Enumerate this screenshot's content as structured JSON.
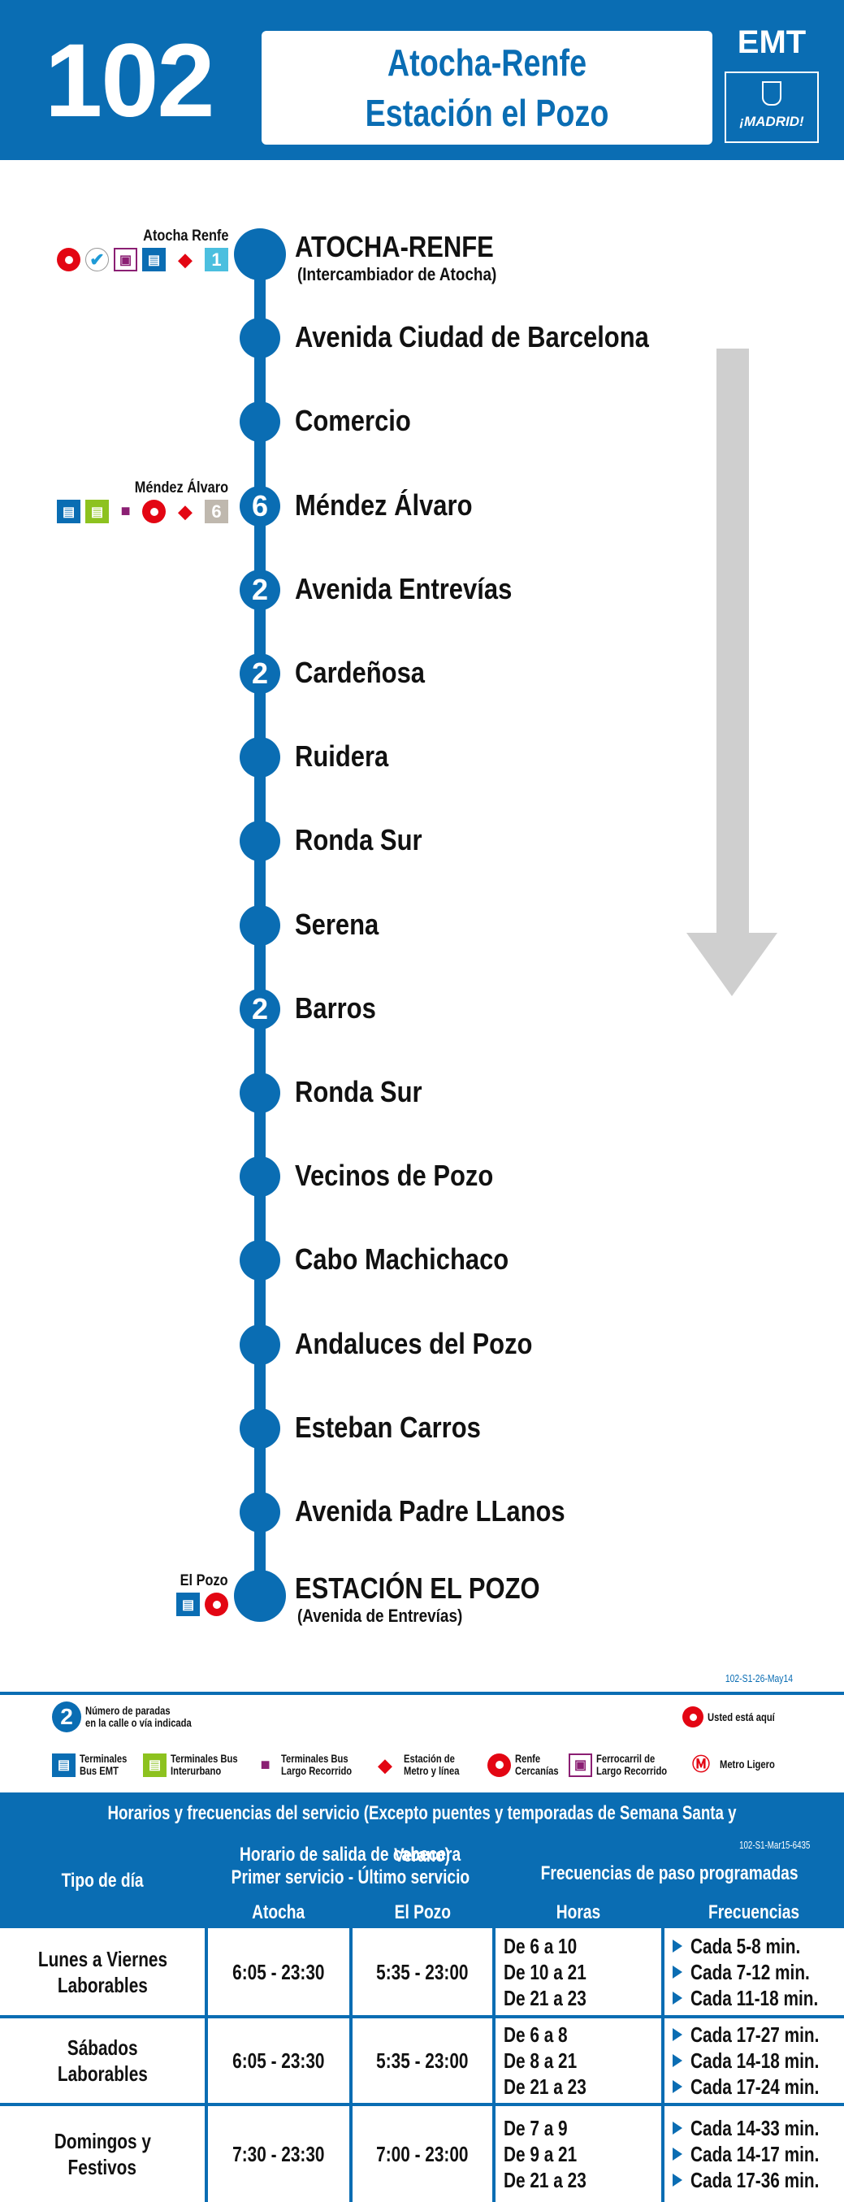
{
  "header": {
    "line_number": "102",
    "destinations": [
      "Atocha-Renfe",
      "Estación el Pozo"
    ],
    "operator": "EMT",
    "city_logo": "¡MADRID!"
  },
  "stops": [
    {
      "name": "ATOCHA-RENFE",
      "sub": "(Intercambiador de Atocha)",
      "badge": "",
      "terminal": true
    },
    {
      "name": "Avenida Ciudad de Barcelona",
      "badge": ""
    },
    {
      "name": "Comercio",
      "badge": ""
    },
    {
      "name": "Méndez Álvaro",
      "badge": "6"
    },
    {
      "name": "Avenida Entrevías",
      "badge": "2"
    },
    {
      "name": "Cardeñosa",
      "badge": "2"
    },
    {
      "name": "Ruidera",
      "badge": ""
    },
    {
      "name": "Ronda Sur",
      "badge": ""
    },
    {
      "name": "Serena",
      "badge": ""
    },
    {
      "name": "Barros",
      "badge": "2"
    },
    {
      "name": "Ronda Sur",
      "badge": ""
    },
    {
      "name": "Vecinos de Pozo",
      "badge": ""
    },
    {
      "name": "Cabo Machichaco",
      "badge": ""
    },
    {
      "name": "Andaluces del Pozo",
      "badge": ""
    },
    {
      "name": "Esteban Carros",
      "badge": ""
    },
    {
      "name": "Avenida Padre LLanos",
      "badge": ""
    },
    {
      "name": "ESTACIÓN EL POZO",
      "sub": "(Avenida de Entrevías)",
      "badge": "",
      "terminal": true
    }
  ],
  "connections": {
    "atocha": {
      "label": "Atocha Renfe",
      "metro_line": "1"
    },
    "mendez": {
      "label": "Méndez Álvaro",
      "metro_line": "6"
    },
    "pozo": {
      "label": "El Pozo"
    }
  },
  "version_map": "102-S1-26-May14",
  "legend": {
    "badge_example": "2",
    "badge_text": [
      "Número de paradas",
      "en la calle o vía indicada"
    ],
    "you_are_here": "Usted está aquí",
    "items": [
      [
        "Terminales",
        "Bus EMT"
      ],
      [
        "Terminales Bus",
        "Interurbano"
      ],
      [
        "Terminales Bus",
        "Largo Recorrido"
      ],
      [
        "Estación de",
        "Metro y línea"
      ],
      [
        "Renfe",
        "Cercanías"
      ],
      [
        "Ferrocarril de",
        "Largo Recorrido"
      ],
      [
        "Metro Ligero",
        ""
      ]
    ]
  },
  "schedule": {
    "title": "Horarios y frecuencias del servicio (Excepto puentes y temporadas de Semana Santa y Verano)",
    "version": "102-S1-Mar15-6435",
    "headers": {
      "day_type": "Tipo de día",
      "departures": [
        "Horario de salida de cabecera",
        "Primer servicio - Último servicio"
      ],
      "frequencies": "Frecuencias de paso programadas",
      "atocha": "Atocha",
      "pozo": "El Pozo",
      "hours": "Horas",
      "freq": "Frecuencias"
    },
    "rows": [
      {
        "day": [
          "Lunes a Viernes",
          "Laborables"
        ],
        "atocha": "6:05 - 23:30",
        "pozo": "5:35 - 23:00",
        "hours": [
          "De 6 a 10",
          "De 10 a 21",
          "De 21 a 23"
        ],
        "freq": [
          "Cada 5-8 min.",
          "Cada 7-12 min.",
          "Cada 11-18 min."
        ]
      },
      {
        "day": [
          "Sábados",
          "Laborables"
        ],
        "atocha": "6:05 - 23:30",
        "pozo": "5:35 - 23:00",
        "hours": [
          "De 6 a 8",
          "De 8 a 21",
          "De 21 a 23"
        ],
        "freq": [
          "Cada 17-27 min.",
          "Cada 14-18 min.",
          "Cada 17-24 min."
        ]
      },
      {
        "day": [
          "Domingos y",
          "Festivos"
        ],
        "atocha": "7:30 - 23:30",
        "pozo": "7:00 - 23:00",
        "hours": [
          "De 7 a 9",
          "De 9 a 21",
          "De 21 a 23"
        ],
        "freq": [
          "Cada 14-33 min.",
          "Cada 14-17 min.",
          "Cada 17-36 min."
        ]
      }
    ]
  },
  "colors": {
    "brand": "#0a6db3",
    "renfe": "#e30613",
    "arrow": "#cfcfcf"
  }
}
